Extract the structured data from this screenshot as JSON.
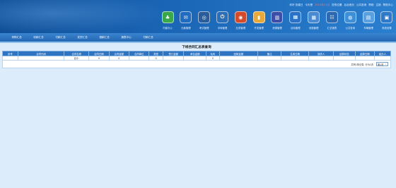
{
  "top_links": [
    "你好 张建日",
    "今天是",
    "2013年11月",
    "您的位置",
    "后台首页",
    "公共查询",
    "帮助",
    "注销",
    "帮助中心"
  ],
  "modules": [
    {
      "label": "内部办公",
      "icon": "people-icon",
      "color": "#3aa84a",
      "glyph": "♣"
    },
    {
      "label": "元素管理",
      "icon": "document-icon",
      "color": "#1f6cc0",
      "glyph": "✉"
    },
    {
      "label": "考试管理",
      "icon": "settings-icon",
      "color": "#2a5d9a",
      "glyph": "◎"
    },
    {
      "label": "中转管理",
      "icon": "power-icon",
      "color": "#2b6fb8",
      "glyph": "⏻"
    },
    {
      "label": "业务管理",
      "icon": "target-icon",
      "color": "#d44a2a",
      "glyph": "◉"
    },
    {
      "label": "开发管理",
      "icon": "folder-icon",
      "color": "#e8a93a",
      "glyph": "▮"
    },
    {
      "label": "资源管理",
      "icon": "book-icon",
      "color": "#3c4ea8",
      "glyph": "▥"
    },
    {
      "label": "目标管理",
      "icon": "chart-icon",
      "color": "#2a73c9",
      "glyph": "Ⅲ"
    },
    {
      "label": "设施管理",
      "icon": "calculator-icon",
      "color": "#4a8ad0",
      "glyph": "▦"
    },
    {
      "label": "汇总报表",
      "icon": "list-icon",
      "color": "#2c69b0",
      "glyph": "☷"
    },
    {
      "label": "公共查询",
      "icon": "globe-icon",
      "color": "#3f8fd6",
      "glyph": "◍"
    },
    {
      "label": "车辆管理",
      "icon": "folders-icon",
      "color": "#5a9fe0",
      "glyph": "▤"
    },
    {
      "label": "系统设置",
      "icon": "monitor-icon",
      "color": "#2e7ac8",
      "glyph": "▣"
    }
  ],
  "nav": [
    "采购汇总",
    "收款汇总",
    "付款汇总",
    "发货汇总",
    "借款汇总",
    "报表中心",
    "付款汇总"
  ],
  "report": {
    "title": "下线合同汇总表查询",
    "columns": [
      "序号",
      "合同代码",
      "合同名称",
      "合同日期",
      "合同金额",
      "合同单位",
      "类型",
      "签订金额",
      "承包金额",
      "毛利",
      "回款金额",
      "备注",
      "生成日期",
      "操作人",
      "结算状态",
      "结算日期",
      "经办人"
    ],
    "total_row": [
      "",
      "",
      "合计:",
      "0",
      "0",
      "",
      "0",
      "",
      "",
      "0",
      "",
      "",
      "",
      "",
      "",
      "",
      ""
    ],
    "pager_text": "共有1条记录, 分为1页",
    "page_select": "第1页"
  }
}
